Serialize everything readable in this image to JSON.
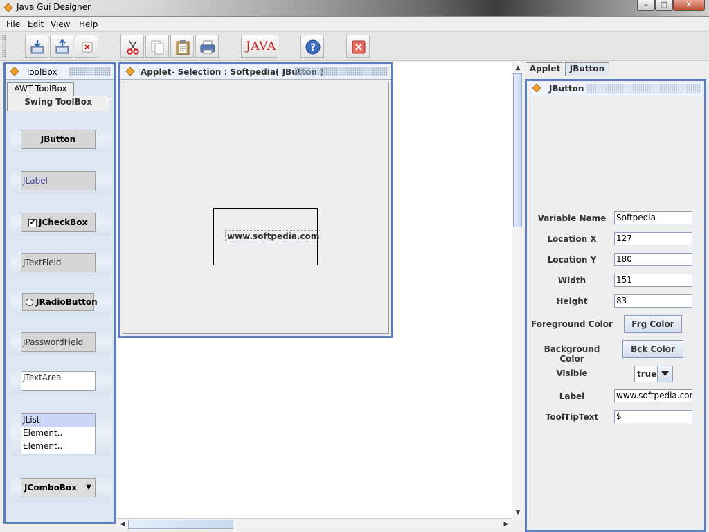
{
  "window": {
    "title": "Java Gui Designer"
  },
  "menu": {
    "items": [
      "File",
      "Edit",
      "View",
      "Help"
    ]
  },
  "toolbar": {
    "buttons": [
      {
        "name": "load-icon"
      },
      {
        "name": "save-icon"
      },
      {
        "name": "close-file-icon"
      },
      {
        "name": "cut-icon"
      },
      {
        "name": "copy-icon"
      },
      {
        "name": "paste-icon"
      },
      {
        "name": "print-icon"
      },
      {
        "name": "java-icon"
      },
      {
        "name": "help-icon"
      },
      {
        "name": "exit-icon"
      }
    ],
    "java_label": "JAVA"
  },
  "toolbox": {
    "title": "ToolBox",
    "tabs": [
      "AWT ToolBox",
      "Swing ToolBox"
    ],
    "active_tab": "Swing ToolBox",
    "components": {
      "jbutton": "JButton",
      "jlabel": "JLabel",
      "jcheckbox": "JCheckBox",
      "jtextfield": "JTextField",
      "jradiobutton": "JRadioButton",
      "jpasswordfield": "JPasswordField",
      "jtextarea": "JTextArea",
      "jlist": [
        "JList",
        "Element..",
        "Element.."
      ],
      "jcombobox": "JComboBox"
    }
  },
  "editor": {
    "title": "Applet- Selection : Softpedia( JButton )",
    "selected_component_text": "www.softpedia.com"
  },
  "properties": {
    "tabs": [
      "Applet",
      "JButton"
    ],
    "active_tab": "JButton",
    "title": "JButton",
    "labels": {
      "variable_name": "Variable Name",
      "location_x": "Location X",
      "location_y": "Location Y",
      "width": "Width",
      "height": "Height",
      "foreground": "Foreground Color",
      "background": "Background Color",
      "visible": "Visible",
      "label": "Label",
      "tooltip": "ToolTipText"
    },
    "values": {
      "variable_name": "Softpedia",
      "location_x": "127",
      "location_y": "180",
      "width": "151",
      "height": "83",
      "visible": "true",
      "label": "www.softpedia.com",
      "tooltip": "$"
    },
    "buttons": {
      "foreground": "Frg Color",
      "background": "Bck Color"
    }
  },
  "colors": {
    "panel_border": "#5a7fc0",
    "java_red": "#c8261e"
  }
}
